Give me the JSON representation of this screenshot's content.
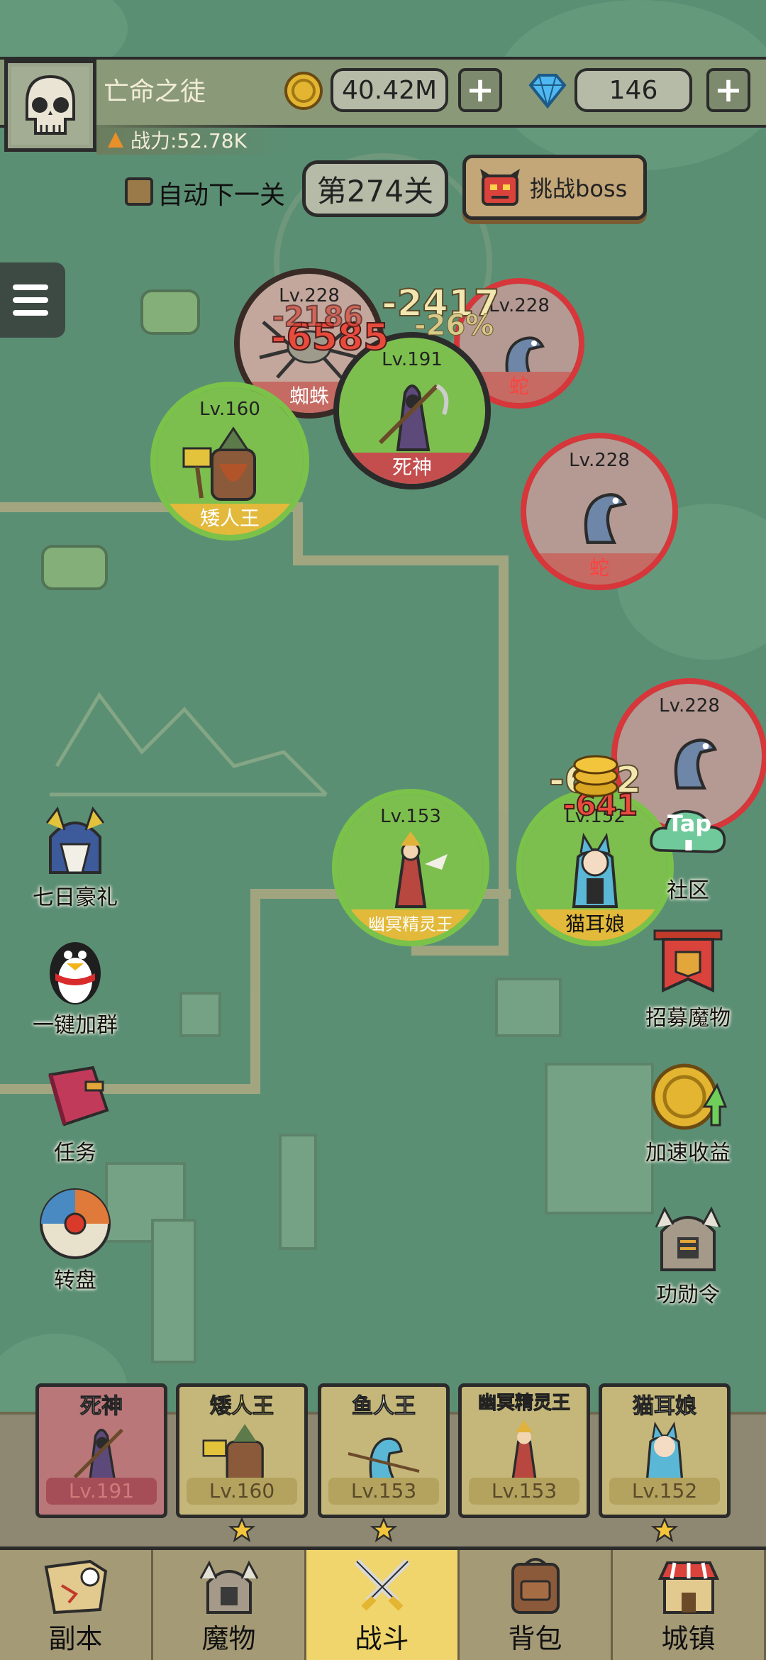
{
  "player": {
    "name": "亡命之徒",
    "power_label": "战力:52.78K"
  },
  "resources": {
    "gold": "40.42M",
    "gems": "146"
  },
  "controls": {
    "auto_next_label": "自动下一关",
    "stage_label": "第274关",
    "boss_label": "挑战boss"
  },
  "field_units": [
    {
      "name": "蜘蛛",
      "level": "Lv.228",
      "team": "enemy"
    },
    {
      "name": "蛇",
      "level": "Lv.228",
      "team": "enemy"
    },
    {
      "name": "死神",
      "level": "Lv.191",
      "team": "ally"
    },
    {
      "name": "矮人王",
      "level": "Lv.160",
      "team": "ally"
    },
    {
      "name": "蛇",
      "level": "Lv.228",
      "team": "enemy"
    },
    {
      "name": "",
      "level": "Lv.228",
      "team": "enemy"
    },
    {
      "name": "幽冥精灵王",
      "level": "Lv.153",
      "team": "ally"
    },
    {
      "name": "猫耳娘",
      "level": "Lv.152",
      "team": "ally"
    }
  ],
  "damage_numbers": [
    "-6585",
    "-2417",
    "-26%",
    "-2186",
    "-632",
    "-641"
  ],
  "left_buttons": [
    "七日豪礼",
    "一键加群",
    "任务",
    "转盘"
  ],
  "right_buttons": [
    "社区",
    "招募魔物",
    "加速收益",
    "功勋令"
  ],
  "tap_badge": "Tap",
  "roster": [
    {
      "name": "死神",
      "level": "Lv.191",
      "stars": 0
    },
    {
      "name": "矮人王",
      "level": "Lv.160",
      "stars": 1
    },
    {
      "name": "鱼人王",
      "level": "Lv.153",
      "stars": 1
    },
    {
      "name": "幽冥精灵王",
      "level": "Lv.153",
      "stars": 0
    },
    {
      "name": "猫耳娘",
      "level": "Lv.152",
      "stars": 1
    }
  ],
  "nav_tabs": [
    "副本",
    "魔物",
    "战斗",
    "背包",
    "城镇"
  ],
  "active_tab": "战斗",
  "colors": {
    "map_bg": "#5b8f74",
    "ally_ring": "#7bc24a",
    "enemy_ring": "#d7363a",
    "active_tab": "#efd56b",
    "gold": "#e3b531",
    "gem": "#4fb8f0"
  }
}
